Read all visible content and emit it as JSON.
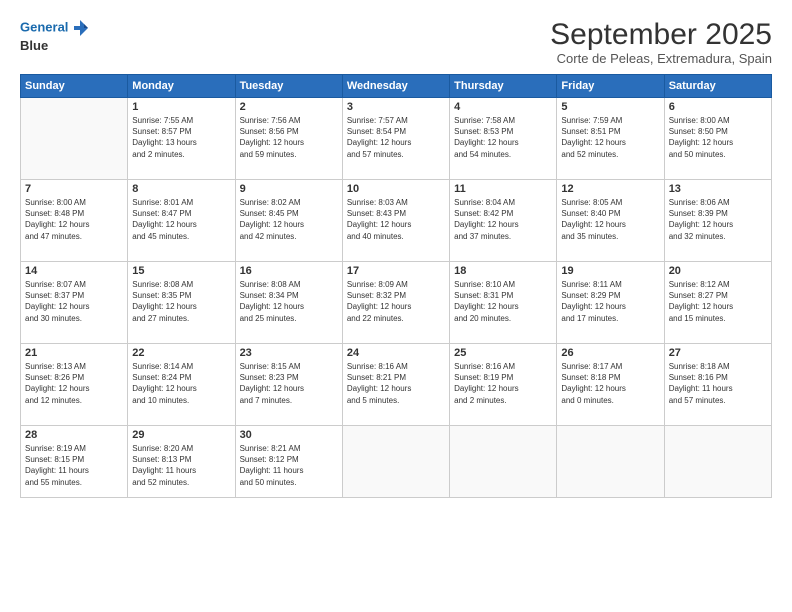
{
  "header": {
    "logo_line1": "General",
    "logo_line2": "Blue",
    "month_title": "September 2025",
    "subtitle": "Corte de Peleas, Extremadura, Spain"
  },
  "days_of_week": [
    "Sunday",
    "Monday",
    "Tuesday",
    "Wednesday",
    "Thursday",
    "Friday",
    "Saturday"
  ],
  "weeks": [
    [
      {
        "day": "",
        "info": ""
      },
      {
        "day": "1",
        "info": "Sunrise: 7:55 AM\nSunset: 8:57 PM\nDaylight: 13 hours\nand 2 minutes."
      },
      {
        "day": "2",
        "info": "Sunrise: 7:56 AM\nSunset: 8:56 PM\nDaylight: 12 hours\nand 59 minutes."
      },
      {
        "day": "3",
        "info": "Sunrise: 7:57 AM\nSunset: 8:54 PM\nDaylight: 12 hours\nand 57 minutes."
      },
      {
        "day": "4",
        "info": "Sunrise: 7:58 AM\nSunset: 8:53 PM\nDaylight: 12 hours\nand 54 minutes."
      },
      {
        "day": "5",
        "info": "Sunrise: 7:59 AM\nSunset: 8:51 PM\nDaylight: 12 hours\nand 52 minutes."
      },
      {
        "day": "6",
        "info": "Sunrise: 8:00 AM\nSunset: 8:50 PM\nDaylight: 12 hours\nand 50 minutes."
      }
    ],
    [
      {
        "day": "7",
        "info": "Sunrise: 8:00 AM\nSunset: 8:48 PM\nDaylight: 12 hours\nand 47 minutes."
      },
      {
        "day": "8",
        "info": "Sunrise: 8:01 AM\nSunset: 8:47 PM\nDaylight: 12 hours\nand 45 minutes."
      },
      {
        "day": "9",
        "info": "Sunrise: 8:02 AM\nSunset: 8:45 PM\nDaylight: 12 hours\nand 42 minutes."
      },
      {
        "day": "10",
        "info": "Sunrise: 8:03 AM\nSunset: 8:43 PM\nDaylight: 12 hours\nand 40 minutes."
      },
      {
        "day": "11",
        "info": "Sunrise: 8:04 AM\nSunset: 8:42 PM\nDaylight: 12 hours\nand 37 minutes."
      },
      {
        "day": "12",
        "info": "Sunrise: 8:05 AM\nSunset: 8:40 PM\nDaylight: 12 hours\nand 35 minutes."
      },
      {
        "day": "13",
        "info": "Sunrise: 8:06 AM\nSunset: 8:39 PM\nDaylight: 12 hours\nand 32 minutes."
      }
    ],
    [
      {
        "day": "14",
        "info": "Sunrise: 8:07 AM\nSunset: 8:37 PM\nDaylight: 12 hours\nand 30 minutes."
      },
      {
        "day": "15",
        "info": "Sunrise: 8:08 AM\nSunset: 8:35 PM\nDaylight: 12 hours\nand 27 minutes."
      },
      {
        "day": "16",
        "info": "Sunrise: 8:08 AM\nSunset: 8:34 PM\nDaylight: 12 hours\nand 25 minutes."
      },
      {
        "day": "17",
        "info": "Sunrise: 8:09 AM\nSunset: 8:32 PM\nDaylight: 12 hours\nand 22 minutes."
      },
      {
        "day": "18",
        "info": "Sunrise: 8:10 AM\nSunset: 8:31 PM\nDaylight: 12 hours\nand 20 minutes."
      },
      {
        "day": "19",
        "info": "Sunrise: 8:11 AM\nSunset: 8:29 PM\nDaylight: 12 hours\nand 17 minutes."
      },
      {
        "day": "20",
        "info": "Sunrise: 8:12 AM\nSunset: 8:27 PM\nDaylight: 12 hours\nand 15 minutes."
      }
    ],
    [
      {
        "day": "21",
        "info": "Sunrise: 8:13 AM\nSunset: 8:26 PM\nDaylight: 12 hours\nand 12 minutes."
      },
      {
        "day": "22",
        "info": "Sunrise: 8:14 AM\nSunset: 8:24 PM\nDaylight: 12 hours\nand 10 minutes."
      },
      {
        "day": "23",
        "info": "Sunrise: 8:15 AM\nSunset: 8:23 PM\nDaylight: 12 hours\nand 7 minutes."
      },
      {
        "day": "24",
        "info": "Sunrise: 8:16 AM\nSunset: 8:21 PM\nDaylight: 12 hours\nand 5 minutes."
      },
      {
        "day": "25",
        "info": "Sunrise: 8:16 AM\nSunset: 8:19 PM\nDaylight: 12 hours\nand 2 minutes."
      },
      {
        "day": "26",
        "info": "Sunrise: 8:17 AM\nSunset: 8:18 PM\nDaylight: 12 hours\nand 0 minutes."
      },
      {
        "day": "27",
        "info": "Sunrise: 8:18 AM\nSunset: 8:16 PM\nDaylight: 11 hours\nand 57 minutes."
      }
    ],
    [
      {
        "day": "28",
        "info": "Sunrise: 8:19 AM\nSunset: 8:15 PM\nDaylight: 11 hours\nand 55 minutes."
      },
      {
        "day": "29",
        "info": "Sunrise: 8:20 AM\nSunset: 8:13 PM\nDaylight: 11 hours\nand 52 minutes."
      },
      {
        "day": "30",
        "info": "Sunrise: 8:21 AM\nSunset: 8:12 PM\nDaylight: 11 hours\nand 50 minutes."
      },
      {
        "day": "",
        "info": ""
      },
      {
        "day": "",
        "info": ""
      },
      {
        "day": "",
        "info": ""
      },
      {
        "day": "",
        "info": ""
      }
    ]
  ]
}
